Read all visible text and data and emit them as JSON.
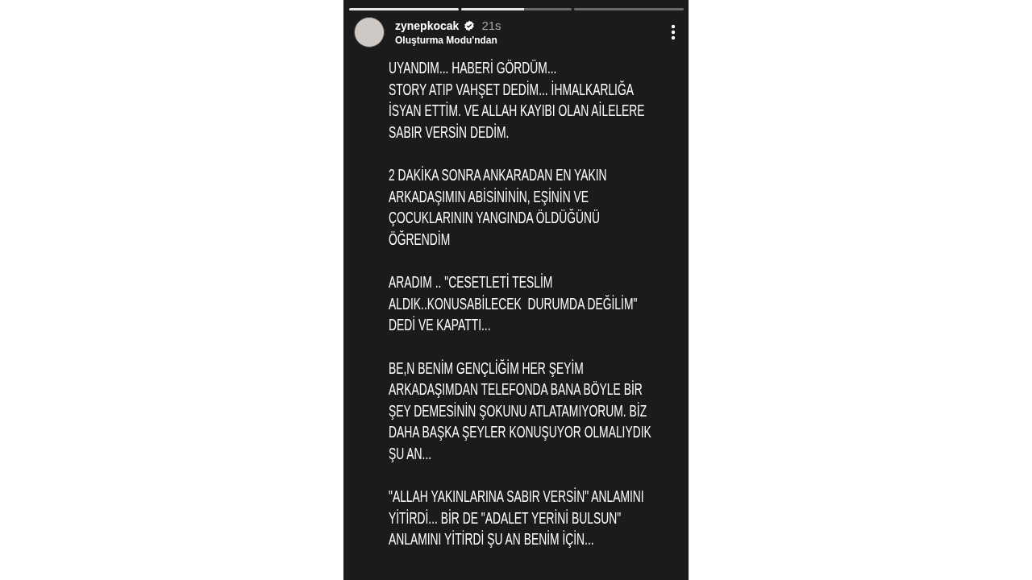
{
  "progress": [
    {
      "level": 1
    },
    {
      "level": 0.57
    },
    {
      "level": 0
    }
  ],
  "header": {
    "username": "zynepkocak",
    "verified": true,
    "time": "21s",
    "subtitle": "Oluşturma Modu'ndan"
  },
  "paragraphs": [
    [
      "UYANDIM... HABERİ GÖRDÜM...",
      "STORY ATIP VAHŞET DEDİM... İHMALKARLIĞA",
      "İSYAN ETTİM. VE ALLAH KAYIBI OLAN AİLELERE",
      "SABIR VERSİN DEDİM."
    ],
    [
      "2 DAKİKA SONRA ANKARADAN EN YAKIN",
      "ARKADAŞIMIN ABİSİNİNİN, EŞİNİN VE",
      "ÇOCUKLARININ YANGINDA ÖLDÜĞÜNÜ",
      "ÖĞRENDİM"
    ],
    [
      "ARADIM .. \"CESETLETİ TESLİM",
      "ALDIK..KONUSABİLECEK  DURUMDA DEĞİLİM\"",
      "DEDİ VE KAPATTI..."
    ],
    [
      "BE,N BENİM GENÇLİĞİM HER ŞEYİM",
      "ARKADAŞIMDAN TELEFONDA BANA BÖYLE BİR",
      "ŞEY DEMESİNİN ŞOKUNU ATLATAMIYORUM. BİZ",
      "DAHA BAŞKA ŞEYLER KONUŞUYOR OLMALIYDIK",
      "ŞU AN..."
    ],
    [
      "\"ALLAH YAKINLARINA SABIR VERSİN\" ANLAMINI",
      "YİTİRDİ... BİR DE \"ADALET YERİNİ BULSUN\"",
      "ANLAMINI YİTİRDİ ŞU AN BENİM İÇİN..."
    ]
  ]
}
